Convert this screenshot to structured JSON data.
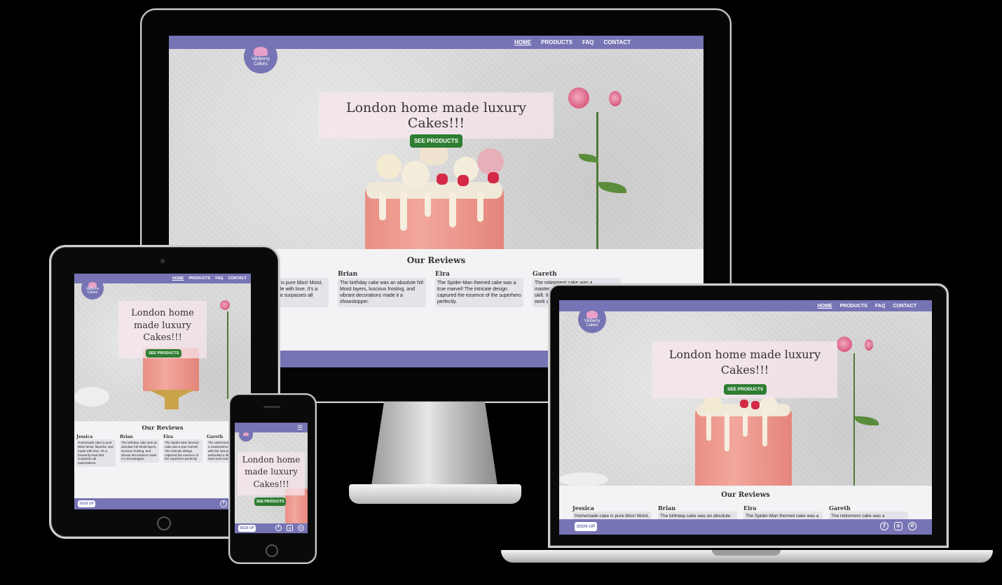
{
  "site": {
    "brand": "VikBerry Cakes",
    "nav": [
      "HOME",
      "PRODUCTS",
      "FAQ",
      "CONTACT"
    ],
    "hero_title": "London home made luxury Cakes!!!",
    "hero_button": "SEE PRODUCTS",
    "reviews_title": "Our Reviews",
    "reviews": [
      {
        "name": "Jessica",
        "text": "Homemade cake is pure bliss! Moist, flavorful, and made with love. It's a heavenly treat that surpasses all expectations."
      },
      {
        "name": "Brian",
        "text": "The birthday cake was an absolute hit! Moist layers, luscious frosting, and vibrant decorations made it a showstopper."
      },
      {
        "name": "Eira",
        "text": "The Spider-Man themed cake was a true marvel! The intricate design captured the essence of the superhero perfectly."
      },
      {
        "name": "Gareth",
        "text": "The retirement cake was a masterpiece, crafted with the utmost skill. It embodied a lifetime of hard work and dedication."
      }
    ],
    "signup": "SIGN UP",
    "socials": [
      "facebook-icon",
      "instagram-icon",
      "whatsapp-icon"
    ],
    "menu_icon": "hamburger-menu-icon"
  },
  "colors": {
    "brand": "#7674b4",
    "button": "#2e7d32",
    "review_bg": "#e3e3e9"
  }
}
